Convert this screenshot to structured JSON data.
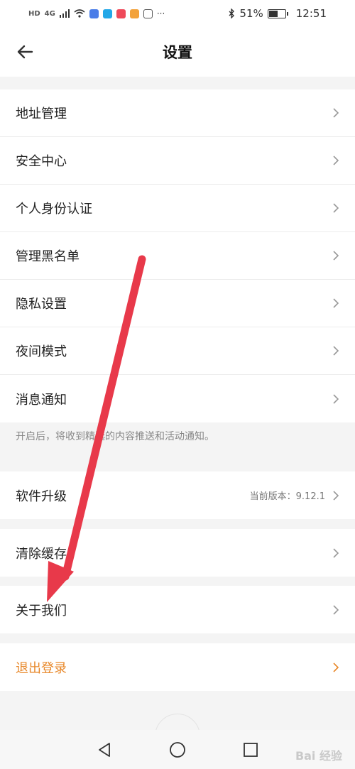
{
  "status": {
    "hd": "HD",
    "net": "4G",
    "battery": "51%",
    "time": "12:51"
  },
  "header": {
    "title": "设置"
  },
  "items": {
    "address": "地址管理",
    "security": "安全中心",
    "identity": "个人身份认证",
    "blacklist": "管理黑名单",
    "privacy": "隐私设置",
    "night": "夜间模式",
    "notify": "消息通知",
    "notify_hint": "开启后，将收到精选的内容推送和活动通知。",
    "upgrade": "软件升级",
    "version": "当前版本：9.12.1",
    "cache": "清除缓存",
    "about": "关于我们",
    "logout": "退出登录"
  },
  "watermark": "Bai 经验",
  "colors": {
    "accent": "#e8882a",
    "arrow": "#e8394a"
  }
}
